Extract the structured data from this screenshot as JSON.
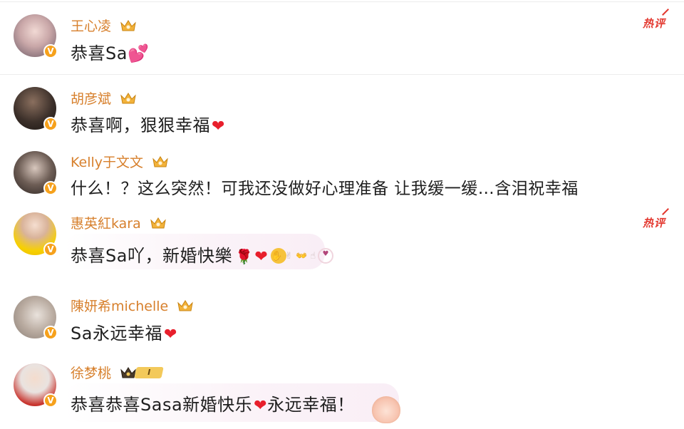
{
  "hot_label": "热评",
  "comments": [
    {
      "name": "王心凌",
      "text": "恭喜Sa💕",
      "hot": true
    },
    {
      "name": "胡彦斌",
      "text": "恭喜啊，狠狠幸福",
      "hot": false
    },
    {
      "name": "Kelly于文文",
      "text": "什么！？这么突然！可我还没做好心理准备 让我缓一缓…含泪祝幸福",
      "hot": false
    },
    {
      "name": "惠英紅kara",
      "text": "恭喜Sa吖，新婚快樂",
      "hot": true
    },
    {
      "name": "陳妍希michelle",
      "text": "Sa永远幸福",
      "hot": false
    },
    {
      "name": "徐梦桃",
      "text": "恭喜恭喜Sasa新婚快乐",
      "text_tail": "永远幸福！",
      "level": "I",
      "hot": false
    }
  ],
  "colors": {
    "name": "#d7802d",
    "hot": "#e3382f",
    "heart": "#e81f2c",
    "verified": "#f6a11c"
  },
  "icons": [
    "crown-icon",
    "verified-badge-icon",
    "heart-emoji-icon",
    "hot-comment-icon",
    "rose-emoji-icon"
  ]
}
